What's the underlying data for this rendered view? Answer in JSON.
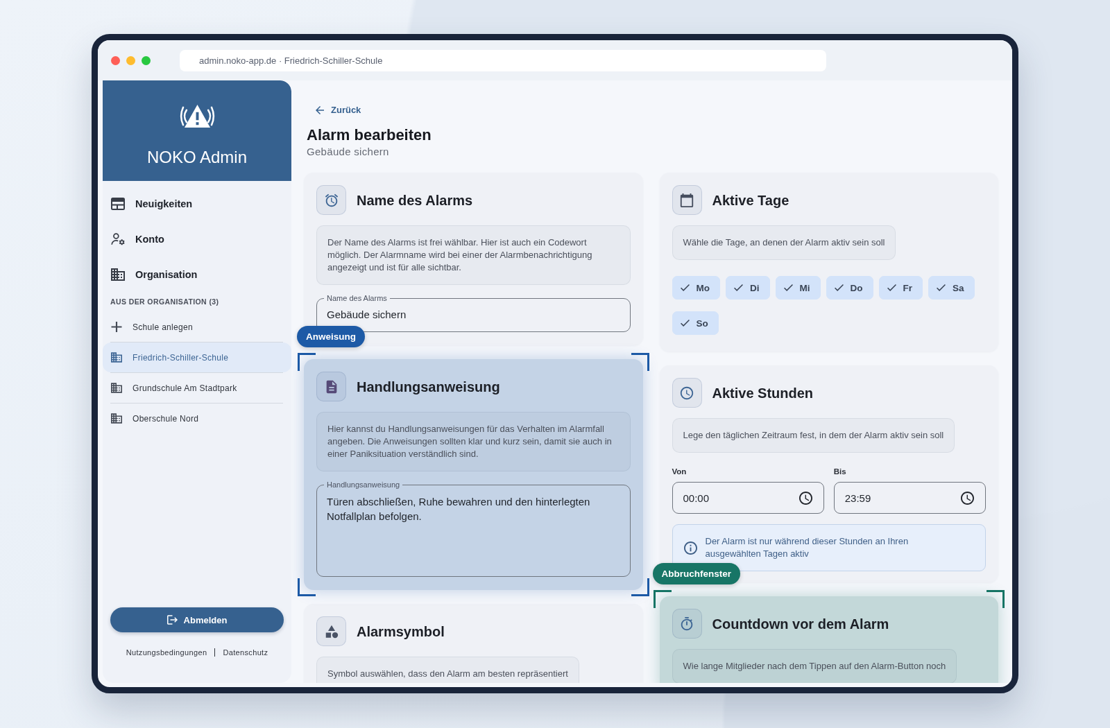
{
  "browser": {
    "address": "admin.noko-app.de · Friedrich-Schiller-Schule"
  },
  "sidebar": {
    "brand": "NOKO Admin",
    "nav_items": [
      {
        "kind": "news",
        "label": "Neuigkeiten",
        "selected": false
      },
      {
        "kind": "account",
        "label": "Konto",
        "selected": false
      },
      {
        "kind": "organisation",
        "label": "Organisation",
        "selected": false
      }
    ],
    "section_title": "AUS DER ORGANISATION (3)",
    "org_items": [
      {
        "kind": "add",
        "label": "Schule anlegen",
        "selected": false
      },
      {
        "kind": "school",
        "label": "Friedrich-Schiller-Schule",
        "selected": true
      },
      {
        "kind": "school",
        "label": "Grundschule Am Stadtpark",
        "selected": false
      },
      {
        "kind": "school",
        "label": "Oberschule Nord",
        "selected": false
      }
    ],
    "logout_button": "Abmelden",
    "footer_links": [
      "Nutzungsbedingungen",
      "Datenschutz"
    ]
  },
  "header": {
    "back_link": "Zurück",
    "title": "Alarm bearbeiten",
    "subtitle": "Gebäude sichern"
  },
  "columns": [
    {
      "cards": [
        {
          "kind": "name",
          "title": "Name des Alarms",
          "description": "Der Name des Alarms ist frei wählbar. Hier ist auch ein Codewort möglich. Der Alarmname wird bei einer der Alarmbenachrichtigung angezeigt und ist für alle sichtbar.",
          "field": {
            "label": "Name des Alarms",
            "value": "Gebäude sichern"
          }
        },
        {
          "kind": "instruction",
          "title": "Handlungsanweisung",
          "description": "Hier kannst du Handlungsanweisungen für das Verhalten im Alarmfall angeben. Die Anweisungen sollten klar und kurz sein, damit sie auch in einer Paniksituation verständlich sind.",
          "textarea": {
            "label": "Handlungsanweisung",
            "value": "Türen abschließen, Ruhe bewahren und den hinterlegten Notfallplan befolgen."
          },
          "callout": {
            "label": "Anweisung",
            "color": "#1d5aa6"
          }
        },
        {
          "kind": "symbol",
          "title": "Alarmsymbol",
          "description": "Symbol auswählen, dass den Alarm am besten repräsentiert"
        }
      ]
    },
    {
      "cards": [
        {
          "kind": "days",
          "title": "Aktive Tage",
          "description": "Wähle die Tage, an denen der Alarm aktiv sein soll",
          "days": [
            {
              "label": "Mo",
              "selected": true
            },
            {
              "label": "Di",
              "selected": true
            },
            {
              "label": "Mi",
              "selected": true
            },
            {
              "label": "Do",
              "selected": true
            },
            {
              "label": "Fr",
              "selected": true
            },
            {
              "label": "Sa",
              "selected": true
            },
            {
              "label": "So",
              "selected": true
            }
          ]
        },
        {
          "kind": "hours",
          "title": "Aktive Stunden",
          "description": "Lege den täglichen Zeitraum fest, in dem der Alarm aktiv sein soll",
          "time_fields": [
            {
              "label": "Von",
              "value": "00:00"
            },
            {
              "label": "Bis",
              "value": "23:59"
            }
          ],
          "info": "Der Alarm ist nur während dieser Stunden an Ihren ausgewählten Tagen aktiv"
        },
        {
          "kind": "countdown",
          "title": "Countdown vor dem Alarm",
          "description": "Wie lange Mitglieder nach dem Tippen auf den Alarm-Button noch",
          "callout": {
            "label": "Abbruchfenster",
            "color": "#177566"
          }
        }
      ]
    }
  ]
}
